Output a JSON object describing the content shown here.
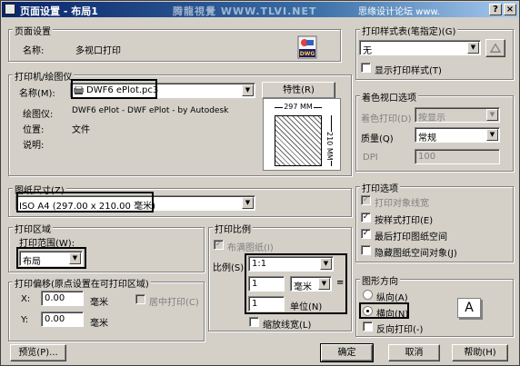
{
  "window": {
    "title": "页面设置 - 布局1",
    "watermark_1": "腾龍視覺 WWW.TLVI.NET",
    "watermark_2": "思缘设计论坛 www.",
    "help_glyph": "?",
    "close_glyph": "×"
  },
  "page_setup": {
    "title": "页面设置",
    "name_label": "名称:",
    "name_value": "多视口打印",
    "dwg_label": "DWG"
  },
  "printer": {
    "title": "打印机/绘图仪",
    "name_label": "名称(M):",
    "name_value": "DWF6 ePlot.pc3",
    "properties_button": "特性(R)",
    "plotter_label": "绘图仪:",
    "plotter_value": "DWF6 ePlot - DWF ePlot - by Autodesk",
    "location_label": "位置:",
    "location_value": "文件",
    "description_label": "说明:",
    "preview_width": "297 MM",
    "preview_height": "210 MM"
  },
  "paper_size": {
    "title": "图纸尺寸(Z)",
    "value": "ISO A4 (297.00 x 210.00 毫米)"
  },
  "plot_area": {
    "title": "打印区域",
    "range_label": "打印范围(W):",
    "range_value": "布局"
  },
  "plot_offset": {
    "title": "打印偏移(原点设置在可打印区域)",
    "x_label": "X:",
    "x_value": "0.00",
    "x_unit": "毫米",
    "y_label": "Y:",
    "y_value": "0.00",
    "y_unit": "毫米",
    "center_label": "居中打印(C)"
  },
  "plot_scale": {
    "title": "打印比例",
    "fit_label": "布满图纸(I)",
    "scale_label": "比例(S):",
    "scale_value": "1:1",
    "value1": "1",
    "unit1": "毫米",
    "equals": "=",
    "value2": "1",
    "unit2": "单位(N)",
    "lineweight_label": "缩放线宽(L)"
  },
  "plot_style": {
    "title": "打印样式表(笔指定)(G)",
    "value": "无",
    "show_label": "显示打印样式(T)"
  },
  "shaded_viewport": {
    "title": "着色视口选项",
    "shade_label": "着色打印(D)",
    "shade_value": "按显示",
    "quality_label": "质量(Q)",
    "quality_value": "常规",
    "dpi_label": "DPI",
    "dpi_value": "100"
  },
  "plot_options": {
    "title": "打印选项",
    "opt1": "打印对象线宽",
    "opt2": "按样式打印(E)",
    "opt3": "最后打印图纸空间",
    "opt4": "隐藏图纸空间对象(J)"
  },
  "orientation": {
    "title": "图形方向",
    "portrait": "纵向(A)",
    "landscape": "横向(N)",
    "reverse": "反向打印(-)",
    "preview_letter": "A"
  },
  "buttons": {
    "preview": "预览(P)...",
    "ok": "确定",
    "cancel": "取消",
    "help": "帮助(H)"
  },
  "glyphs": {
    "check": "✓",
    "arrow": "▼"
  }
}
